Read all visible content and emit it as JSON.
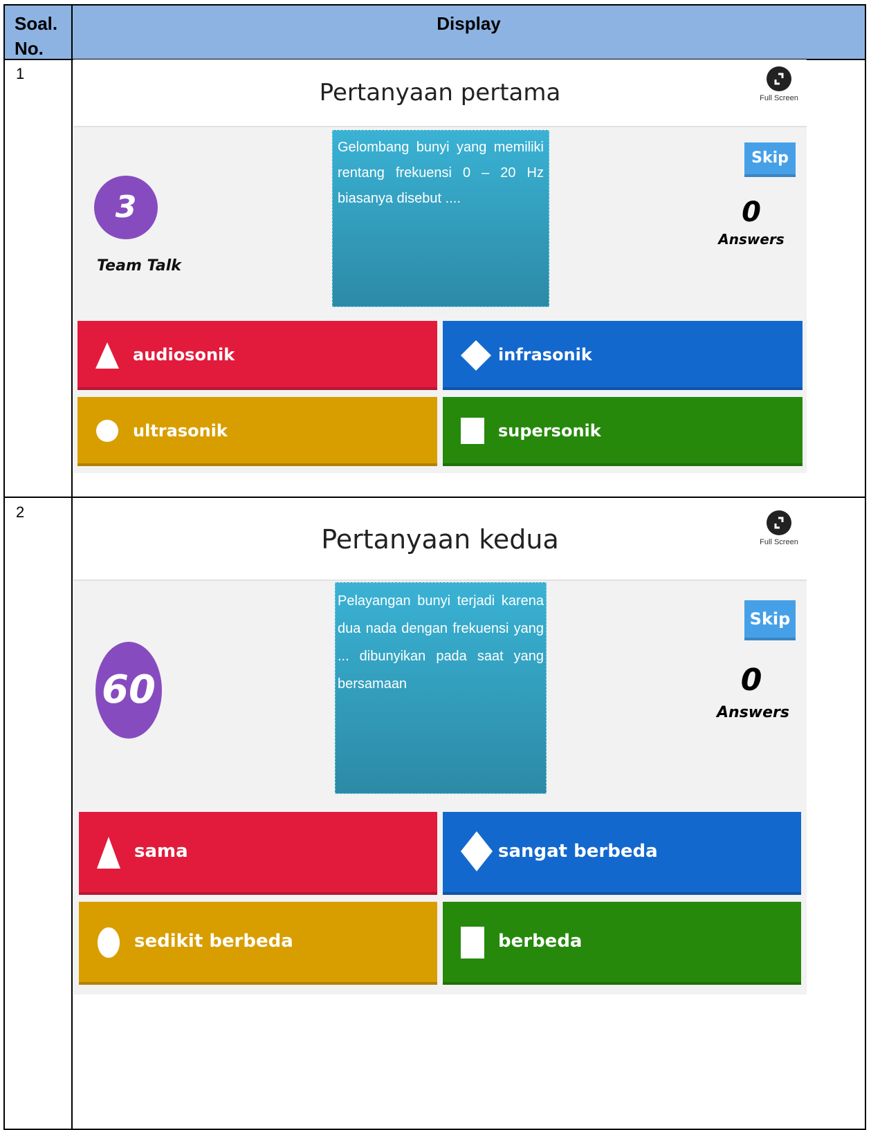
{
  "table": {
    "header_no": "Soal. No.",
    "header_display": "Display"
  },
  "rows": [
    {
      "number": "1",
      "title": "Pertanyaan pertama",
      "fullscreen_label": "Full Screen",
      "timer": "3",
      "timer_caption": "Team Talk",
      "question": "Gelombang bunyi yang memiliki rentang frekuensi 0 – 20 Hz biasanya disebut ....",
      "skip_label": "Skip",
      "answers_count": "0",
      "answers_label": "Answers",
      "choices": [
        {
          "shape": "triangle-icon",
          "label": "audiosonik",
          "color": "#e21b3c"
        },
        {
          "shape": "diamond-icon",
          "label": "infrasonik",
          "color": "#1368ce"
        },
        {
          "shape": "circle-icon",
          "label": "ultrasonik",
          "color": "#d89e00"
        },
        {
          "shape": "square-icon",
          "label": "supersonik",
          "color": "#26890c"
        }
      ]
    },
    {
      "number": "2",
      "title": "Pertanyaan kedua",
      "fullscreen_label": "Full Screen",
      "timer": "60",
      "question": "Pelayangan bunyi terjadi karena dua nada dengan frekuensi yang ... dibunyikan pada saat yang bersamaan",
      "skip_label": "Skip",
      "answers_count": "0",
      "answers_label": "Answers",
      "choices": [
        {
          "shape": "triangle-icon",
          "label": "sama",
          "color": "#e21b3c"
        },
        {
          "shape": "diamond-icon",
          "label": "sangat berbeda",
          "color": "#1368ce"
        },
        {
          "shape": "circle-icon",
          "label": "sedikit berbeda",
          "color": "#d89e00"
        },
        {
          "shape": "square-icon",
          "label": "berbeda",
          "color": "#26890c"
        }
      ]
    }
  ]
}
